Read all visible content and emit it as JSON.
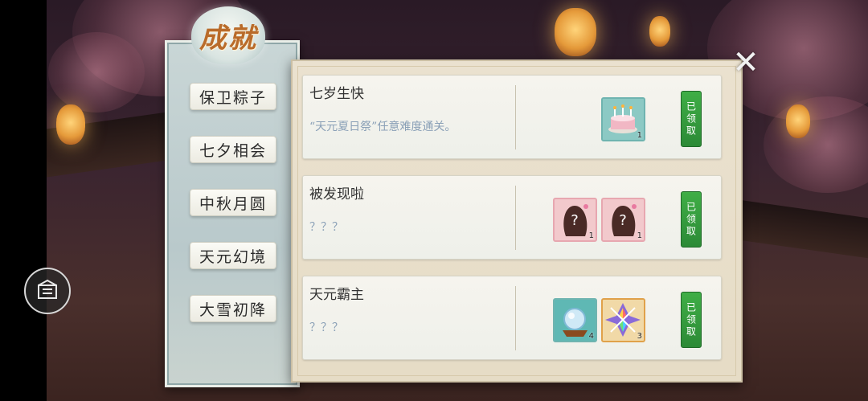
{
  "panel_title": "成就",
  "menu": {
    "items": [
      {
        "label": "保卫粽子"
      },
      {
        "label": "七夕相会"
      },
      {
        "label": "中秋月圆"
      },
      {
        "label": "天元幻境"
      },
      {
        "label": "大雪初降"
      }
    ]
  },
  "close_label": "✕",
  "achievements": [
    {
      "title": "七岁生快",
      "description": "“天元夏日祭”任意难度通关。",
      "rewards": [
        {
          "icon": "birthday-cake-icon",
          "qty": "1"
        }
      ],
      "claim_label": "已领取"
    },
    {
      "title": "被发现啦",
      "description": "？？？",
      "rewards": [
        {
          "icon": "mystery-silhouette-icon",
          "qty": "1"
        },
        {
          "icon": "mystery-silhouette-icon",
          "qty": "1"
        }
      ],
      "claim_label": "已领取"
    },
    {
      "title": "天元霸主",
      "description": "？？？",
      "rewards": [
        {
          "icon": "crystal-orb-icon",
          "qty": "4"
        },
        {
          "icon": "rainbow-crystal-icon",
          "qty": "3"
        }
      ],
      "claim_label": "已领取"
    }
  ],
  "colors": {
    "claim_green": "#3fae46",
    "desc_blue": "#8aa0b7",
    "title_orange": "#b96b2a"
  }
}
